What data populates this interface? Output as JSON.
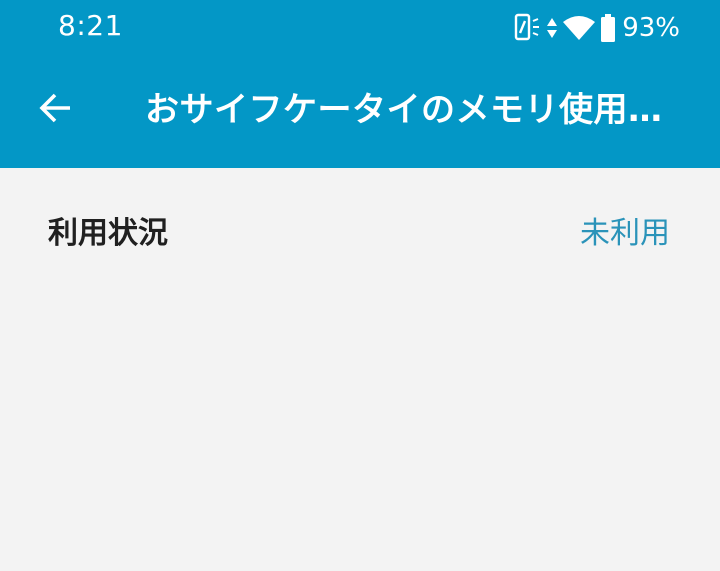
{
  "status_bar": {
    "time": "8:21",
    "battery_percent": "93%",
    "icons": [
      "nfc-phone-icon",
      "data-arrows-icon",
      "wifi-icon",
      "battery-icon"
    ]
  },
  "app_bar": {
    "back_icon": "arrow-left-icon",
    "title": "おサイフケータイのメモリ使用状況"
  },
  "settings": {
    "rows": [
      {
        "label": "利用状況",
        "value": "未利用"
      }
    ]
  },
  "colors": {
    "header_bg": "#0397c6",
    "page_bg": "#f3f3f3",
    "value_text": "#2a93b9",
    "label_text": "#202020"
  }
}
